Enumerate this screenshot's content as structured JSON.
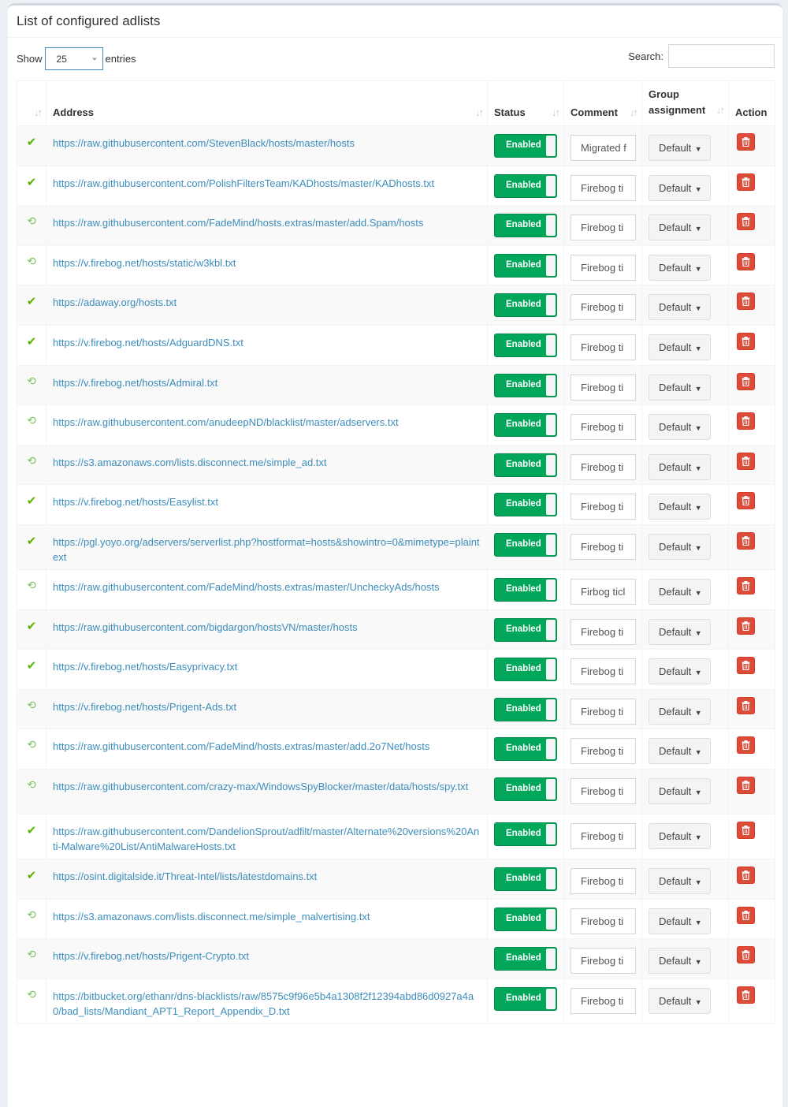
{
  "box": {
    "title": "List of configured adlists"
  },
  "toolbar": {
    "show_label": "Show",
    "page_length": "25",
    "entries_label": "entries",
    "search_label": "Search:",
    "search_value": ""
  },
  "columns": {
    "status_icon": "",
    "address": "Address",
    "status": "Status",
    "comment": "Comment",
    "group": "Group assignment",
    "action": "Action"
  },
  "colors": {
    "link": "#3c8dbc",
    "enabled": "#00a65a",
    "danger": "#dd4b39",
    "check": "#5cb300",
    "history": "#7cc45e"
  },
  "rows": [
    {
      "state": "check",
      "address": "https://raw.githubusercontent.com/StevenBlack/hosts/master/hosts",
      "status": "Enabled",
      "comment": "Migrated f",
      "group": "Default"
    },
    {
      "state": "check",
      "address": "https://raw.githubusercontent.com/PolishFiltersTeam/KADhosts/master/KADhosts.txt",
      "status": "Enabled",
      "comment": "Firebog ti",
      "group": "Default"
    },
    {
      "state": "history",
      "address": "https://raw.githubusercontent.com/FadeMind/hosts.extras/master/add.Spam/hosts",
      "status": "Enabled",
      "comment": "Firebog ti",
      "group": "Default"
    },
    {
      "state": "history",
      "address": "https://v.firebog.net/hosts/static/w3kbl.txt",
      "status": "Enabled",
      "comment": "Firebog ti",
      "group": "Default"
    },
    {
      "state": "check",
      "address": "https://adaway.org/hosts.txt",
      "status": "Enabled",
      "comment": "Firebog ti",
      "group": "Default"
    },
    {
      "state": "check",
      "address": "https://v.firebog.net/hosts/AdguardDNS.txt",
      "status": "Enabled",
      "comment": "Firebog ti",
      "group": "Default"
    },
    {
      "state": "history",
      "address": "https://v.firebog.net/hosts/Admiral.txt",
      "status": "Enabled",
      "comment": "Firebog ti",
      "group": "Default"
    },
    {
      "state": "history",
      "address": "https://raw.githubusercontent.com/anudeepND/blacklist/master/adservers.txt",
      "status": "Enabled",
      "comment": "Firebog ti",
      "group": "Default"
    },
    {
      "state": "history",
      "address": "https://s3.amazonaws.com/lists.disconnect.me/simple_ad.txt",
      "status": "Enabled",
      "comment": "Firebog ti",
      "group": "Default"
    },
    {
      "state": "check",
      "address": "https://v.firebog.net/hosts/Easylist.txt",
      "status": "Enabled",
      "comment": "Firebog ti",
      "group": "Default"
    },
    {
      "state": "check",
      "address": "https://pgl.yoyo.org/adservers/serverlist.php?hostformat=hosts&showintro=0&mimetype=plaintext",
      "status": "Enabled",
      "comment": "Firebog ti",
      "group": "Default",
      "tall": true
    },
    {
      "state": "history",
      "address": "https://raw.githubusercontent.com/FadeMind/hosts.extras/master/UncheckyAds/hosts",
      "status": "Enabled",
      "comment": "Firbog ticl",
      "group": "Default"
    },
    {
      "state": "check",
      "address": "https://raw.githubusercontent.com/bigdargon/hostsVN/master/hosts",
      "status": "Enabled",
      "comment": "Firebog ti",
      "group": "Default"
    },
    {
      "state": "check",
      "address": "https://v.firebog.net/hosts/Easyprivacy.txt",
      "status": "Enabled",
      "comment": "Firebog ti",
      "group": "Default"
    },
    {
      "state": "history",
      "address": "https://v.firebog.net/hosts/Prigent-Ads.txt",
      "status": "Enabled",
      "comment": "Firebog ti",
      "group": "Default"
    },
    {
      "state": "history",
      "address": "https://raw.githubusercontent.com/FadeMind/hosts.extras/master/add.2o7Net/hosts",
      "status": "Enabled",
      "comment": "Firebog ti",
      "group": "Default"
    },
    {
      "state": "history",
      "address": "https://raw.githubusercontent.com/crazy-max/WindowsSpyBlocker/master/data/hosts/spy.txt",
      "status": "Enabled",
      "comment": "Firebog ti",
      "group": "Default",
      "tall": true
    },
    {
      "state": "check",
      "address": "https://raw.githubusercontent.com/DandelionSprout/adfilt/master/Alternate%20versions%20Anti-Malware%20List/AntiMalwareHosts.txt",
      "status": "Enabled",
      "comment": "Firebog ti",
      "group": "Default",
      "tall": true
    },
    {
      "state": "check",
      "address": "https://osint.digitalside.it/Threat-Intel/lists/latestdomains.txt",
      "status": "Enabled",
      "comment": "Firebog ti",
      "group": "Default"
    },
    {
      "state": "history",
      "address": "https://s3.amazonaws.com/lists.disconnect.me/simple_malvertising.txt",
      "status": "Enabled",
      "comment": "Firebog ti",
      "group": "Default"
    },
    {
      "state": "history",
      "address": "https://v.firebog.net/hosts/Prigent-Crypto.txt",
      "status": "Enabled",
      "comment": "Firebog ti",
      "group": "Default"
    },
    {
      "state": "history",
      "address": "https://bitbucket.org/ethanr/dns-blacklists/raw/8575c9f96e5b4a1308f2f12394abd86d0927a4a0/bad_lists/Mandiant_APT1_Report_Appendix_D.txt",
      "status": "Enabled",
      "comment": "Firebog ti",
      "group": "Default",
      "tall": true
    }
  ]
}
